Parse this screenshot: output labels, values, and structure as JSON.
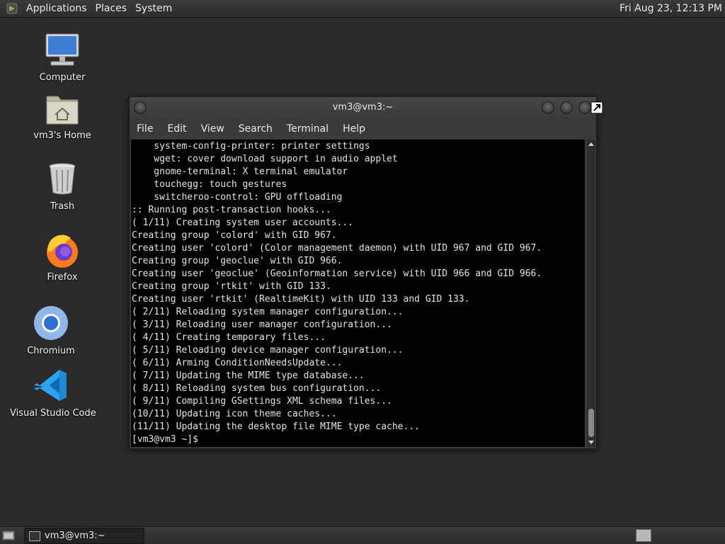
{
  "top_panel": {
    "menu": [
      "Applications",
      "Places",
      "System"
    ],
    "clock": "Fri Aug 23, 12:13 PM"
  },
  "desktop_icons": [
    {
      "label": "Computer",
      "icon": "computer-icon"
    },
    {
      "label": "vm3's Home",
      "icon": "home-folder-icon"
    },
    {
      "label": "Trash",
      "icon": "trash-icon"
    },
    {
      "label": "Firefox",
      "icon": "firefox-icon"
    },
    {
      "label": "Chromium",
      "icon": "chromium-icon"
    },
    {
      "label": "Visual Studio Code",
      "icon": "vscode-icon"
    }
  ],
  "terminal": {
    "title": "vm3@vm3:~",
    "menu": [
      "File",
      "Edit",
      "View",
      "Search",
      "Terminal",
      "Help"
    ],
    "lines": [
      "    system-config-printer: printer settings",
      "    wget: cover download support in audio applet",
      "    gnome-terminal: X terminal emulator",
      "    touchegg: touch gestures",
      "    switcheroo-control: GPU offloading",
      ":: Running post-transaction hooks...",
      "( 1/11) Creating system user accounts...",
      "Creating group 'colord' with GID 967.",
      "Creating user 'colord' (Color management daemon) with UID 967 and GID 967.",
      "Creating group 'geoclue' with GID 966.",
      "Creating user 'geoclue' (Geoinformation service) with UID 966 and GID 966.",
      "Creating group 'rtkit' with GID 133.",
      "Creating user 'rtkit' (RealtimeKit) with UID 133 and GID 133.",
      "( 2/11) Reloading system manager configuration...",
      "( 3/11) Reloading user manager configuration...",
      "( 4/11) Creating temporary files...",
      "( 5/11) Reloading device manager configuration...",
      "( 6/11) Arming ConditionNeedsUpdate...",
      "( 7/11) Updating the MIME type database...",
      "( 8/11) Reloading system bus configuration...",
      "( 9/11) Compiling GSettings XML schema files...",
      "(10/11) Updating icon theme caches...",
      "(11/11) Updating the desktop file MIME type cache...",
      "[vm3@vm3 ~]$ "
    ]
  },
  "bottom_panel": {
    "task_label": "vm3@vm3:~"
  }
}
